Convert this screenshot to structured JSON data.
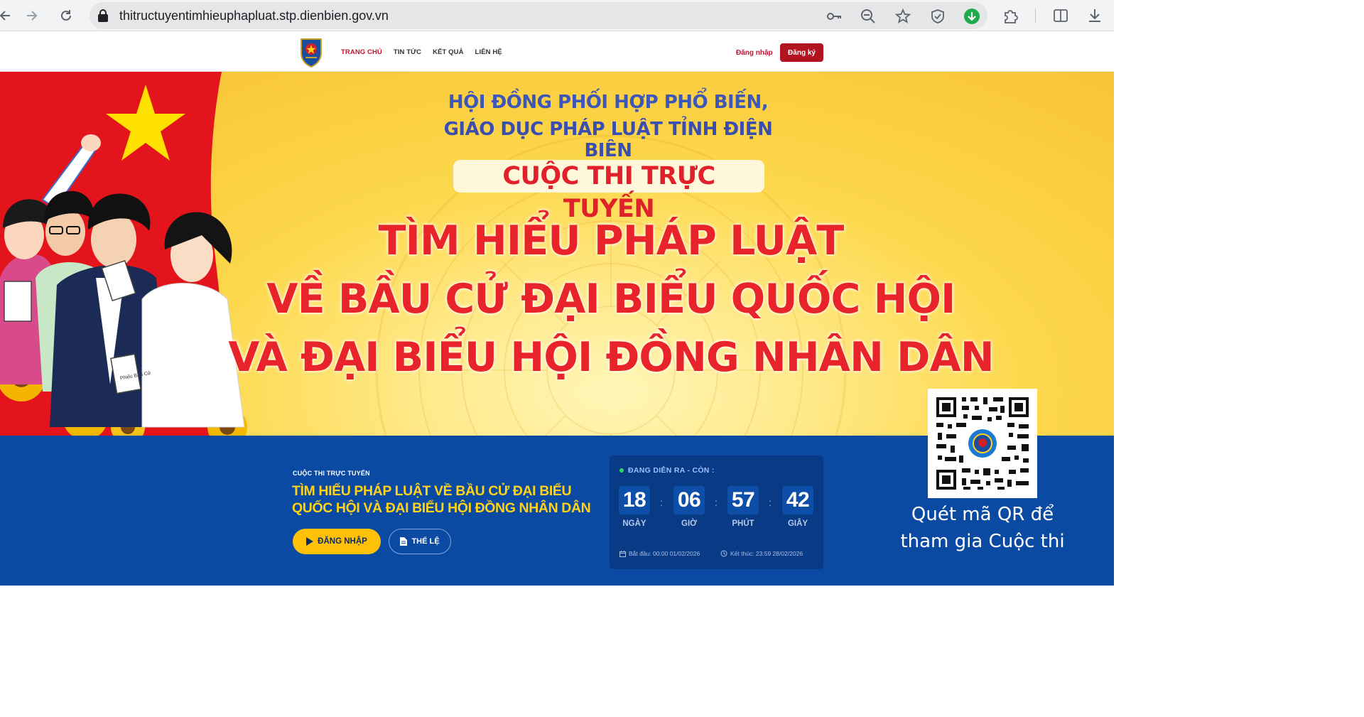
{
  "browser": {
    "url": "thitructuyentimhieuphapluat.stp.dienbien.gov.vn",
    "icons": [
      "back-icon",
      "forward-icon",
      "reload-icon",
      "lock-icon",
      "password-key-icon",
      "zoom-out-icon",
      "bookmark-star-icon",
      "shield-icon",
      "download-status-icon",
      "extensions-icon",
      "split-screen-icon",
      "downloads-icon"
    ]
  },
  "header": {
    "nav": [
      "TRANG CHỦ",
      "TIN TỨC",
      "KẾT QUẢ",
      "LIÊN HỆ"
    ],
    "login": "Đăng nhập",
    "register": "Đăng ký"
  },
  "banner": {
    "org_line1": "HỘI ĐỒNG PHỐI HỢP PHỔ BIẾN,",
    "org_line2": "GIÁO DỤC PHÁP LUẬT TỈNH ĐIỆN BIÊN",
    "contest": "CUỘC THI TRỰC TUYẾN",
    "title_line1": "TÌM HIỂU PHÁP LUẬT",
    "title_line2": "VỀ BẦU CỬ ĐẠI BIỂU QUỐC HỘI",
    "title_line3": "VÀ ĐẠI BIỂU HỘI ĐỒNG NHÂN DÂN",
    "ballot_label": "Phiếu Bầu Cử"
  },
  "info": {
    "kicker": "CUỘC THI TRỰC TUYẾN",
    "title": "TÌM HIỂU PHÁP LUẬT VỀ BẦU CỬ ĐẠI BIỂU QUỐC HỘI VÀ ĐẠI BIỂU HỘI ĐỒNG NHÂN DÂN",
    "btn_login": "ĐĂNG NHẬP",
    "btn_rules": "THỂ LỆ"
  },
  "countdown": {
    "status": "ĐANG DIỄN RA - CÒN :",
    "days": "18",
    "days_label": "NGÀY",
    "hours": "06",
    "hours_label": "GIỜ",
    "minutes": "57",
    "minutes_label": "PHÚT",
    "seconds": "42",
    "seconds_label": "GIÂY",
    "start": "Bắt đầu: 00:00 01/02/2026",
    "end": "Kết thúc: 23:59 28/02/2026"
  },
  "qr": {
    "caption_line1": "Quét mã QR để",
    "caption_line2": "tham gia Cuộc thi"
  },
  "colors": {
    "brand_red": "#c8102e",
    "banner_yellow": "#fdd84c",
    "info_blue": "#0b4aa2",
    "title_yellow": "#ffd21a"
  }
}
